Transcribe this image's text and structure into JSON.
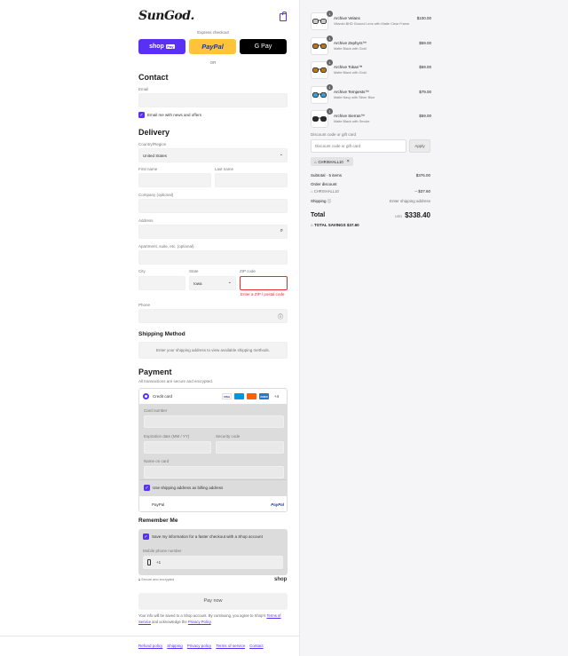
{
  "brand": "SunGod.",
  "express": {
    "label": "Express checkout",
    "shop_label": "shop",
    "shop_badge": "Pay",
    "paypal_label": "PayPal",
    "gpay_label": "G Pay",
    "or": "OR"
  },
  "contact": {
    "title": "Contact",
    "email_placeholder": "Email",
    "newsletter_label": "Email me with news and offers"
  },
  "delivery": {
    "title": "Delivery",
    "country_label": "Country/Region",
    "country_value": "United States",
    "first_name": "First name",
    "last_name": "Last name",
    "company": "Company (optional)",
    "address": "Address",
    "apartment": "Apartment, suite, etc. (optional)",
    "city": "City",
    "state_label": "State",
    "state_value": "Iowa",
    "zip_label": "ZIP code",
    "zip_error": "Enter a ZIP / postal code",
    "phone": "Phone"
  },
  "shipping": {
    "title": "Shipping Method",
    "message": "Enter your shipping address to view available shipping methods."
  },
  "payment": {
    "title": "Payment",
    "subtitle": "All transactions are secure and encrypted.",
    "credit_card": "Credit card",
    "more_cards": "+4",
    "card_number": "Card number",
    "expiry": "Expiration date (MM / YY)",
    "security": "Security code",
    "name_on_card": "Name on card",
    "billing_same": "Use shipping address as billing address",
    "paypal": "PayPal",
    "paypal_logo": "PayPal",
    "card_brands": [
      "VISA",
      "",
      "",
      "AMEX"
    ]
  },
  "remember": {
    "title": "Remember Me",
    "save_label": "Save my information for a faster checkout with a Shop account",
    "mobile_label": "Mobile phone number",
    "phone_prefix": "+1",
    "secure_note": "Secure and encrypted",
    "shop_logo": "shop"
  },
  "pay_button": "Pay now",
  "legal": {
    "text1": "Your info will be saved to a Shop account. By continuing, you agree to Shop's ",
    "terms": "Terms of Service",
    "text2": " and acknowledge the ",
    "privacy": "Privacy Policy",
    "text3": "."
  },
  "footer_links": [
    "Refund policy",
    "Shipping",
    "Privacy policy",
    "Terms of service",
    "Contact"
  ],
  "cart": {
    "items": [
      {
        "name": "Archive Velans",
        "variant": "Vitamin BHD Ground Lens with Matte Clear Frame",
        "price": "$100.00",
        "qty": "1",
        "lens": "#c9c9c9"
      },
      {
        "name": "Archive Zephyrs™",
        "variant": "Matte Black with Gold",
        "price": "$59.00",
        "qty": "1",
        "lens": "#b7791f"
      },
      {
        "name": "Archive Tokas™",
        "variant": "Matte Black with Gold",
        "price": "$59.00",
        "qty": "1",
        "lens": "#b7791f"
      },
      {
        "name": "Archive Tempests™",
        "variant": "Matte Navy with Silver Blue",
        "price": "$79.00",
        "qty": "1",
        "lens": "#3b9fd8"
      },
      {
        "name": "Archive Sierras™",
        "variant": "Matte Black with Smoke",
        "price": "$59.00",
        "qty": "1",
        "lens": "#2a2a2a"
      }
    ]
  },
  "discount": {
    "label": "Discount code or gift card",
    "placeholder": "Discount code or gift card",
    "apply": "Apply",
    "code": "CHRISHALL10"
  },
  "summary": {
    "subtotal_label": "Subtotal · 5 items",
    "subtotal": "$376.00",
    "order_discount": "Order discount",
    "code": "CHRISHALL10",
    "discount_value": "– $37.60",
    "shipping_label": "Shipping",
    "shipping_value": "Enter shipping address",
    "total_label": "Total",
    "currency": "USD",
    "total": "$338.40",
    "savings_label": "TOTAL SAVINGS",
    "savings": "$37.60"
  },
  "colors": {
    "accent": "#5a31f4",
    "error": "#e32c2b",
    "paypal": "#ffc439"
  }
}
